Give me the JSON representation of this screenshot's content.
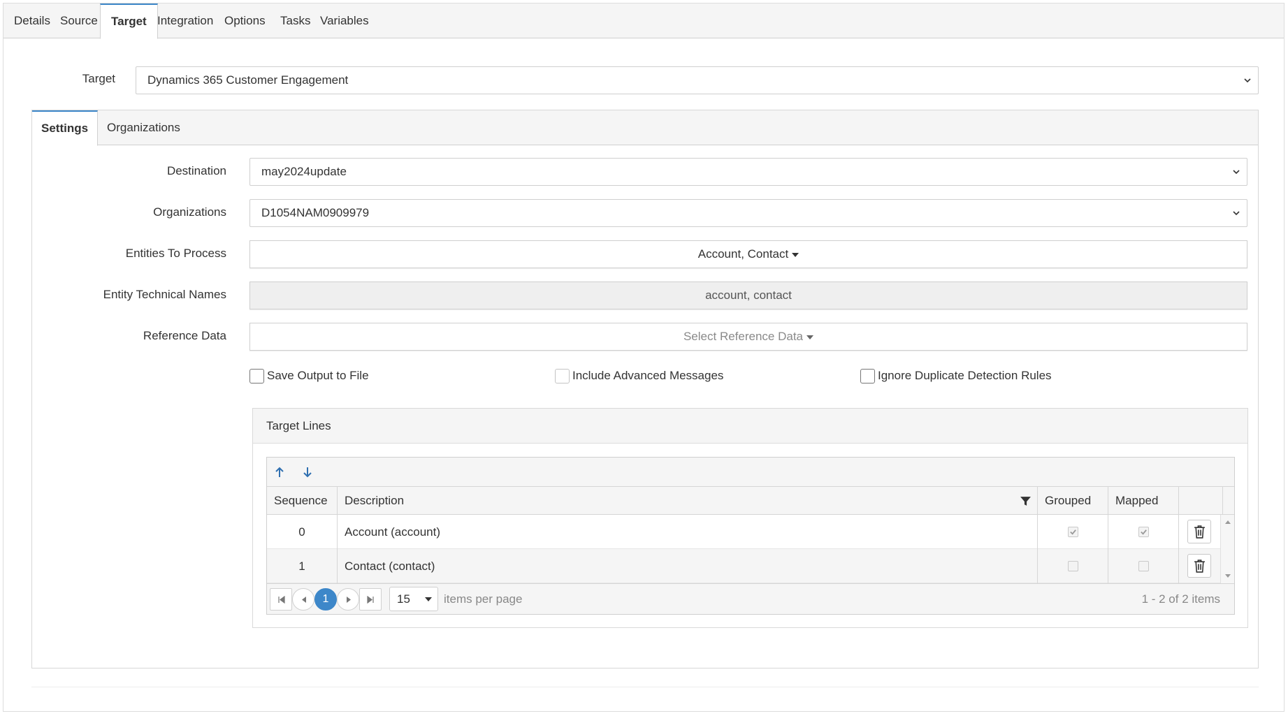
{
  "top_tabs": [
    "Details",
    "Source",
    "Target",
    "Integration",
    "Options",
    "Tasks",
    "Variables"
  ],
  "active_top_tab": "Target",
  "target": {
    "label": "Target",
    "value": "Dynamics 365 Customer Engagement"
  },
  "settings_tabs": [
    "Settings",
    "Organizations"
  ],
  "active_settings_tab": "Settings",
  "form": {
    "destination": {
      "label": "Destination",
      "value": "may2024update"
    },
    "organizations": {
      "label": "Organizations",
      "value": "D1054NAM0909979"
    },
    "entities": {
      "label": "Entities To Process",
      "value": "Account, Contact"
    },
    "entity_names": {
      "label": "Entity Technical Names",
      "value": "account, contact"
    },
    "reference_data": {
      "label": "Reference Data",
      "placeholder": "Select Reference Data"
    }
  },
  "checkboxes": {
    "save_output": {
      "label": "Save Output to File",
      "checked": false
    },
    "advanced_messages": {
      "label": "Include Advanced Messages",
      "checked": false
    },
    "ignore_duplicate": {
      "label": "Ignore Duplicate Detection Rules",
      "checked": false
    }
  },
  "target_lines": {
    "title": "Target Lines",
    "columns": [
      "Sequence",
      "Description",
      "Grouped",
      "Mapped"
    ],
    "rows": [
      {
        "sequence": "0",
        "description": "Account (account)",
        "grouped": true,
        "mapped": true
      },
      {
        "sequence": "1",
        "description": "Contact (contact)",
        "grouped": false,
        "mapped": false
      }
    ],
    "pager": {
      "current_page": "1",
      "page_size": "15",
      "items_per_page_label": "items per page",
      "summary": "1 - 2 of 2 items"
    }
  },
  "icons": [
    "chevron-down-icon",
    "caret-down-icon",
    "arrow-up-icon",
    "arrow-down-icon",
    "filter-icon",
    "trash-icon",
    "first-page-icon",
    "prev-page-icon",
    "next-page-icon",
    "last-page-icon",
    "scroll-up-icon",
    "scroll-down-icon"
  ],
  "colors": {
    "accent": "#3d87c9"
  }
}
